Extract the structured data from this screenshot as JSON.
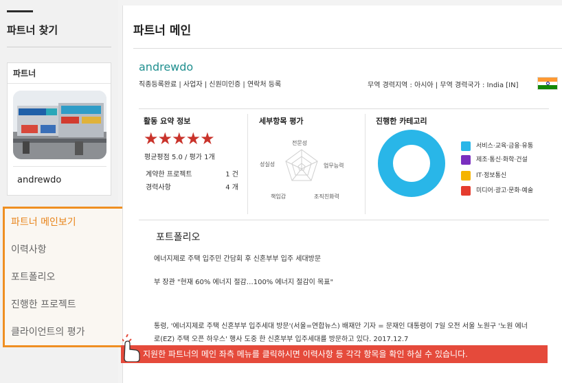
{
  "sidebar": {
    "title": "파트너 찾기",
    "card_header": "파트너",
    "partner_name": "andrewdo",
    "menu": [
      {
        "label": "파트너 메인보기",
        "icon": "+"
      },
      {
        "label": "이력사항"
      },
      {
        "label": "포트폴리오"
      },
      {
        "label": "진행한 프로젝트"
      },
      {
        "label": "클라이언트의 평가"
      }
    ]
  },
  "main": {
    "page_title": "파트너 메인",
    "username": "andrewdo",
    "status_line": "직종등록완료 | 사업자 | 신원미인증 | 연락처 등록",
    "trade_line": "무역 경력지역 : 아시아   |   무역 경력국가 : India [IN]",
    "activity": {
      "title": "활동 요약 정보",
      "stars": 5,
      "stars_glyph": "★★★★★",
      "average": "평균평점 5.0 / 평가 1개",
      "rows": [
        {
          "label": "계약한 프로젝트",
          "value": "1 건"
        },
        {
          "label": "경력사항",
          "value": "4 개"
        }
      ]
    },
    "detail": {
      "title": "세부항목 평가",
      "axes": [
        "전문성",
        "업무능력",
        "조직친화력",
        "책임감",
        "성실성"
      ]
    },
    "category": {
      "title": "진행한 카테고리",
      "items": [
        {
          "label": "서비스·교육·금융·유통",
          "color": "#29b6e8"
        },
        {
          "label": "제조·통신·화학·건설",
          "color": "#7a2fbf"
        },
        {
          "label": "IT·정보통신",
          "color": "#f5b400"
        },
        {
          "label": "미디어·광고·문화·예술",
          "color": "#e53c2e"
        }
      ]
    },
    "portfolio": {
      "title": "포트폴리오",
      "lines": [
        "에너지제로 주택 입주민 간담회 후 신혼부부 입주 세대방문",
        "부 장관 \"현재 60% 에너지 절감…100% 에너지 절감이 목표\"",
        "통령, '에너지제로 주택 신혼부부 입주세대 방문'(서울=연합뉴스) 배재만 기자 = 문재인 대통령이 7일 오전 서울 노원구 '노원 에너",
        "로(EZ) 주택 오픈 하우스' 행사 도중 한 신혼부부 입주세대를 방문하고 있다. 2017.12.7"
      ]
    }
  },
  "banner": {
    "text": "지원한 파트너의 메인 좌측 메뉴를 클릭하시면 이력사항 등 각각 항목을  확인 하실 수 있습니다."
  }
}
